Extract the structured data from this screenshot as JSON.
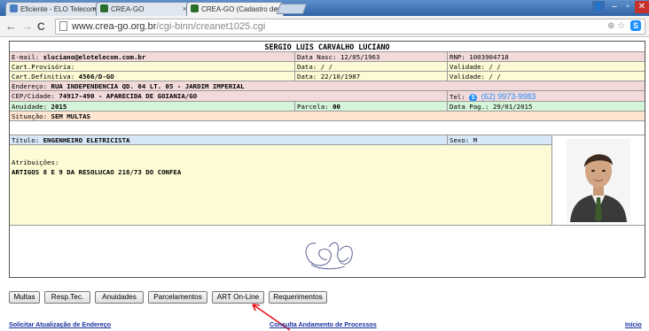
{
  "browser": {
    "tabs": [
      {
        "title": "Eficiente - ELO Telecomu",
        "color": "#4a7fc1"
      },
      {
        "title": "CREA-GO",
        "color": "#2b6e2b"
      },
      {
        "title": "CREA-GO (Cadastro de P",
        "color": "#2b6e2b"
      }
    ],
    "close_glyph": "×",
    "url_host": "www.crea-go.org.br",
    "url_path": "/cgi-binn/creanet1025.cgi",
    "back_glyph": "←",
    "forward_glyph": "→",
    "reload_glyph": "C",
    "minimize_glyph": "–",
    "restore_glyph": "▫",
    "close_window_glyph": "✕",
    "user_glyph": "👤",
    "search_glyph": "⊕",
    "star_glyph": "☆",
    "ext_glyph": "S"
  },
  "record": {
    "name": "SERGIO LUIS CARVALHO LUCIANO",
    "email_label": "E-mail:",
    "email": "sluciano@elotelecom.com.br",
    "nasc_label": "Data Nasc:",
    "nasc": "12/05/1963",
    "rnp_label": "RNP:",
    "rnp": "1003904718",
    "prov_label": "Cart.Provisória:",
    "prov_data_label": "Data:",
    "prov_data": "/ /",
    "prov_val_label": "Validade:",
    "prov_val": "/ /",
    "def_label": "Cart.Definitiva:",
    "def": "4566/D-GO",
    "def_data_label": "Data:",
    "def_data": "22/10/1987",
    "def_val_label": "Validade:",
    "def_val": "/ /",
    "end_label": "Endereço:",
    "endereco": "RUA INDEPENDENCIA QD. 04 LT. 05 - JARDIM IMPERIAL",
    "cep_label": "CEP/Cidade:",
    "cep": "74917-490 - APARECIDA DE GOIANIA/GO",
    "tel_label": "Tel:",
    "tel": "(62) 9973-9983",
    "anuidade_label": "Anuidade:",
    "anuidade": "2015",
    "parcela_label": "Parcela:",
    "parcela": "00",
    "datapag_label": "Data Pag.:",
    "datapag": "29/01/2015",
    "situacao_label": "Situação:",
    "situacao": "SEM MULTAS",
    "titulo_label": "Título:",
    "titulo": "ENGENHEIRO ELETRICISTA",
    "sexo_label": "Sexo:",
    "sexo": "M",
    "atrib_label": "Atribuições:",
    "atrib": "ARTIGOS 8 E 9 DA RESOLUCAO 218/73 DO CONFEA"
  },
  "buttons": [
    "Multas",
    "Resp.Tec.",
    "Anuidades",
    "Parcelamentos",
    "ART On-Line",
    "Requerimentos"
  ],
  "footer": {
    "update_address": "Solicitar Atualização de Endereço",
    "process_status": "Consulta Andamento de Processos",
    "home": "Início"
  },
  "colors": {
    "link": "#1a2f9e",
    "tel": "#1e8fff",
    "annotation_arrow": "#e8141a"
  }
}
